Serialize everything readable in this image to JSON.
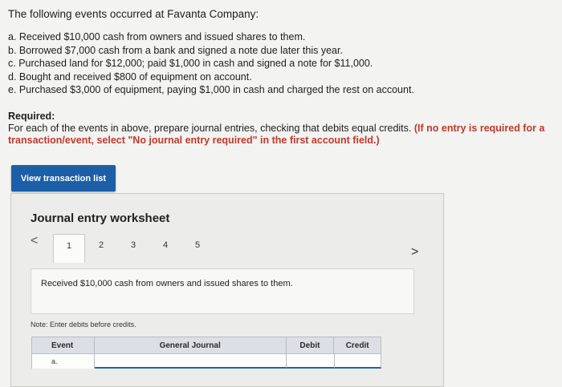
{
  "intro": "The following events occurred at Favanta Company:",
  "events": [
    "a. Received $10,000 cash from owners and issued shares to them.",
    "b. Borrowed $7,000 cash from a bank and signed a note due later this year.",
    "c. Purchased land for $12,000; paid $1,000 in cash and signed a note for $11,000.",
    "d. Bought and received $800 of equipment on account.",
    "e. Purchased $3,000 of equipment, paying $1,000 in cash and charged the rest on account."
  ],
  "required": {
    "title": "Required:",
    "text": "For each of the events in above, prepare journal entries, checking that debits equal credits.",
    "note": "(If no entry is required for a transaction/event, select \"No journal entry required\" in the first account field.)"
  },
  "view_button": "View transaction list",
  "worksheet": {
    "title": "Journal entry worksheet",
    "prev": "<",
    "next": ">",
    "tabs": [
      "1",
      "2",
      "3",
      "4",
      "5"
    ],
    "active_tab": "1",
    "description": "Received $10,000 cash from owners and issued shares to them.",
    "note": "Note: Enter debits before credits.",
    "table": {
      "headers": {
        "event": "Event",
        "journal": "General Journal",
        "debit": "Debit",
        "credit": "Credit"
      },
      "rows": [
        {
          "event": "a.",
          "account": "",
          "debit": "",
          "credit": ""
        }
      ]
    }
  },
  "colors": {
    "accent": "#1c5fa8",
    "required_note": "#c0392b"
  }
}
